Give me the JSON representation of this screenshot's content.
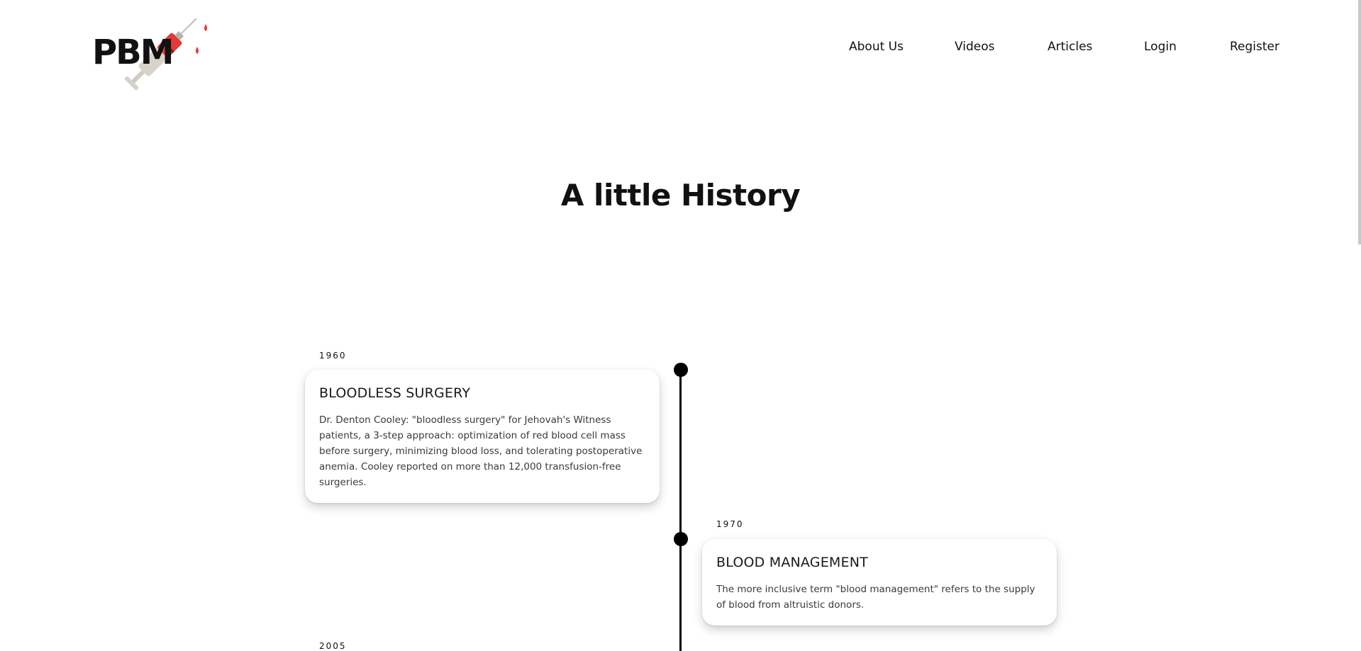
{
  "brand": {
    "logo_text": "PBM"
  },
  "nav": [
    {
      "label": "About Us"
    },
    {
      "label": "Videos"
    },
    {
      "label": "Articles"
    },
    {
      "label": "Login"
    },
    {
      "label": "Register"
    }
  ],
  "main": {
    "title": "A little History"
  },
  "timeline": [
    {
      "year": "1960",
      "title": "BLOODLESS SURGERY",
      "text": "Dr. Denton Cooley: \"bloodless surgery\" for Jehovah's Witness patients, a 3-step approach: optimization of red blood cell mass before surgery, minimizing blood loss, and tolerating postoperative anemia. Cooley reported on more than 12,000 transfusion-free surgeries."
    },
    {
      "year": "1970",
      "title": "BLOOD MANAGEMENT",
      "text": "The more inclusive term \"blood management\" refers to the supply of blood from altruistic donors."
    },
    {
      "year": "2005"
    }
  ],
  "colors": {
    "accent": "#e53935",
    "text": "#111111",
    "line": "#000000"
  },
  "icons": {
    "logo": "syringe-icon"
  }
}
